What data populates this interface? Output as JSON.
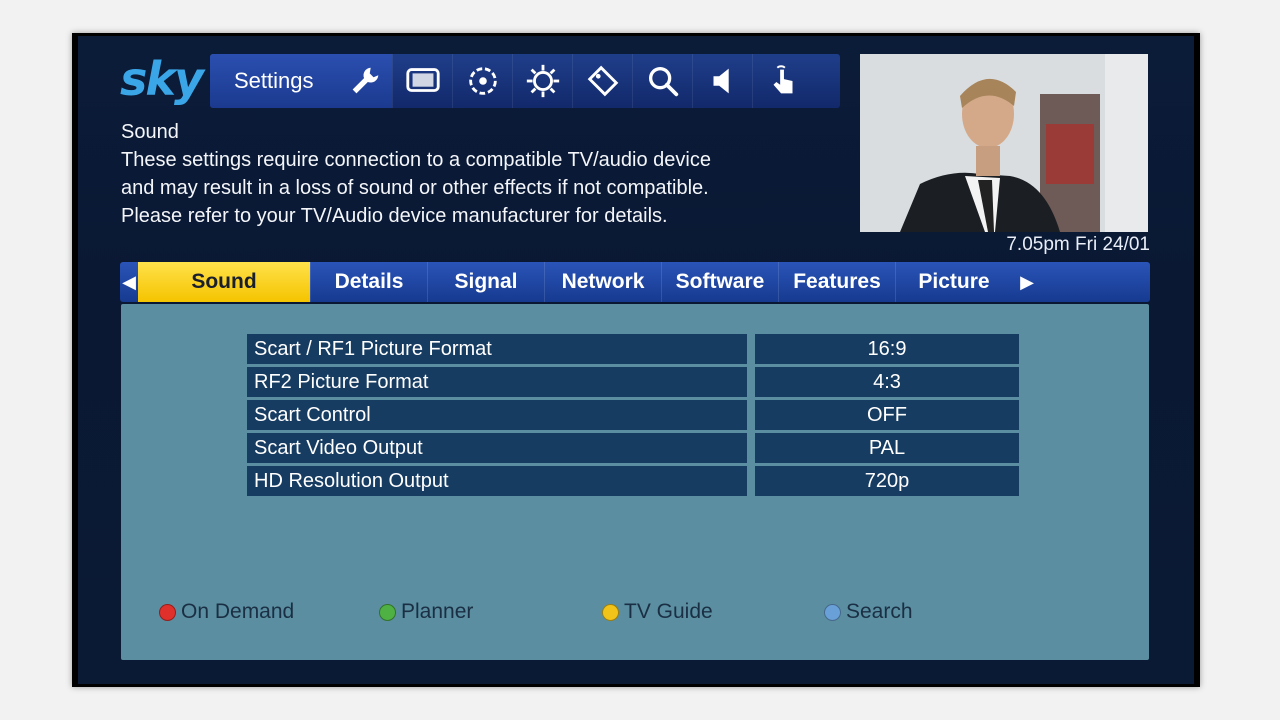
{
  "header": {
    "logo_text": "sky",
    "section_label": "Settings",
    "icons": [
      "wrench-icon",
      "tv-icon",
      "target-icon",
      "gear-icon",
      "tag-icon",
      "search-icon",
      "speaker-icon",
      "touch-icon"
    ]
  },
  "clock": "7.05pm Fri 24/01",
  "description": {
    "title": "Sound",
    "lines": [
      "These settings require connection to a compatible TV/audio device",
      "and may result in a loss of sound or other effects if not compatible.",
      "Please refer to your TV/Audio device manufacturer for details."
    ]
  },
  "tabs": [
    {
      "label": "Sound",
      "active": true
    },
    {
      "label": "Details"
    },
    {
      "label": "Signal"
    },
    {
      "label": "Network"
    },
    {
      "label": "Software"
    },
    {
      "label": "Features"
    },
    {
      "label": "Picture"
    }
  ],
  "settings": [
    {
      "label": "Scart / RF1 Picture Format",
      "value": "16:9"
    },
    {
      "label": "RF2 Picture Format",
      "value": "4:3"
    },
    {
      "label": "Scart Control",
      "value": "OFF"
    },
    {
      "label": "Scart Video Output",
      "value": "PAL"
    },
    {
      "label": "HD Resolution Output",
      "value": "720p"
    }
  ],
  "legend": [
    {
      "label": "On Demand",
      "color": "#e0302b"
    },
    {
      "label": "Planner",
      "color": "#4fb043"
    },
    {
      "label": "TV Guide",
      "color": "#f2c318"
    },
    {
      "label": "Search",
      "color": "#6aa0d8"
    }
  ]
}
